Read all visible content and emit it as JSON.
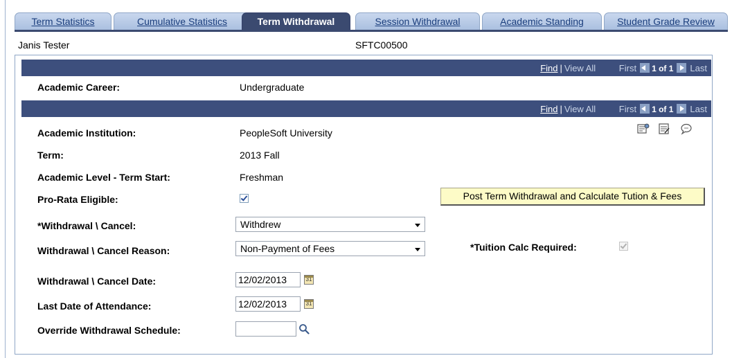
{
  "tabs": [
    {
      "label": "Term Statistics",
      "active": false
    },
    {
      "label": "Cumulative Statistics",
      "active": false
    },
    {
      "label": "Term Withdrawal",
      "active": true
    },
    {
      "label": "Session Withdrawal",
      "active": false
    },
    {
      "label": "Academic Standing",
      "active": false
    },
    {
      "label": "Student Grade Review",
      "active": false
    }
  ],
  "header": {
    "student_name": "Janis Tester",
    "student_id": "SFTC00500"
  },
  "nav_outer": {
    "find": "Find",
    "separator": "|",
    "view_all": "View All",
    "first": "First",
    "count": "1 of 1",
    "last": "Last"
  },
  "career": {
    "label": "Academic Career:",
    "value": "Undergraduate"
  },
  "nav_inner": {
    "find": "Find",
    "separator": "|",
    "view_all": "View All",
    "first": "First",
    "count": "1 of 1",
    "last": "Last"
  },
  "fields": {
    "institution": {
      "label": "Academic Institution:",
      "value": "PeopleSoft University"
    },
    "term": {
      "label": "Term:",
      "value": "2013 Fall"
    },
    "level": {
      "label": "Academic Level - Term Start:",
      "value": "Freshman"
    },
    "prorata": {
      "label": "Pro-Rata Eligible:",
      "checked": true
    },
    "withdrawal_cancel": {
      "label": "*Withdrawal \\ Cancel:",
      "value": "Withdrew"
    },
    "withdrawal_reason": {
      "label": "Withdrawal \\ Cancel Reason:",
      "value": "Non-Payment of Fees"
    },
    "tuition_calc": {
      "label": "*Tuition Calc Required:",
      "checked": true
    },
    "withdrawal_date": {
      "label": "Withdrawal \\ Cancel Date:",
      "value": "12/02/2013"
    },
    "last_attendance": {
      "label": "Last Date of Attendance:",
      "value": "12/02/2013"
    },
    "override_schedule": {
      "label": "Override Withdrawal Schedule:",
      "value": ""
    }
  },
  "buttons": {
    "post_withdrawal": "Post Term Withdrawal and Calculate Tution & Fees"
  },
  "calendar_icon_text": "31",
  "colors": {
    "nav_bar": "#3d4f7d",
    "active_tab": "#3b4a70",
    "inactive_tab": "#b4c7e4",
    "post_button": "#fdfbc7"
  }
}
